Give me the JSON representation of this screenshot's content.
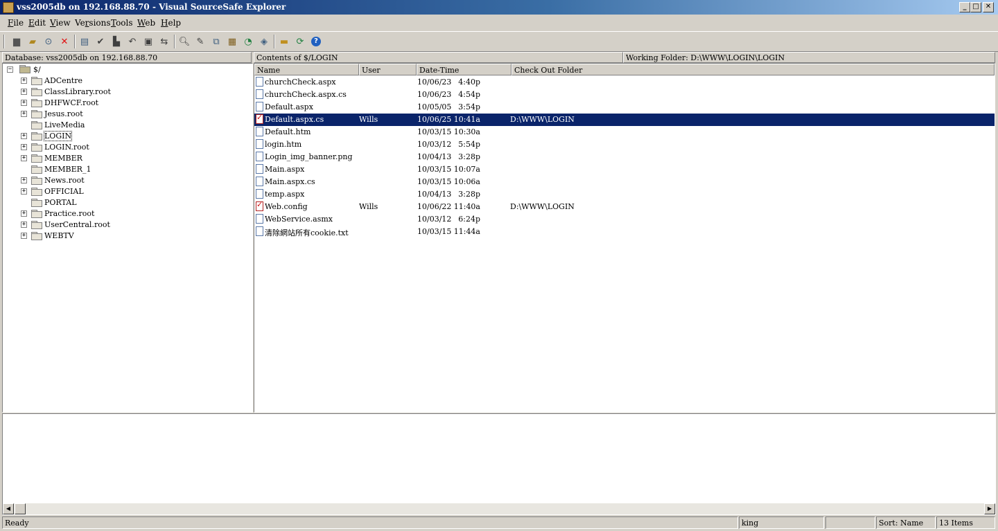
{
  "window": {
    "title": "vss2005db on 192.168.88.70 - Visual SourceSafe Explorer"
  },
  "menu": [
    {
      "key": "F",
      "rest": "ile"
    },
    {
      "key": "E",
      "rest": "dit"
    },
    {
      "key": "V",
      "rest": "iew"
    },
    {
      "pre": "Ve",
      "key": "r",
      "rest": "sions"
    },
    {
      "key": "T",
      "rest": "ools"
    },
    {
      "key": "W",
      "rest": "eb"
    },
    {
      "key": "H",
      "rest": "elp"
    }
  ],
  "toolbar_icons": [
    "create-project-icon",
    "add-files-icon",
    "share-icon",
    "delete-icon",
    "get-latest-icon",
    "check-out-icon",
    "check-in-icon",
    "undo-checkout-icon",
    "label-icon",
    "branch-icon",
    "find-icon",
    "edit-icon",
    "show-differences-icon",
    "properties-icon",
    "show-history-icon",
    "view-file-icon",
    "set-working-folder-icon",
    "refresh-icon",
    "help-icon"
  ],
  "tree_header": "Database: vss2005db on 192.168.88.70",
  "tree": {
    "root": "$/",
    "items": [
      {
        "label": "ADCentre",
        "expandable": true
      },
      {
        "label": "ClassLibrary.root",
        "expandable": true
      },
      {
        "label": "DHFWCF.root",
        "expandable": true
      },
      {
        "label": "Jesus.root",
        "expandable": true
      },
      {
        "label": "LiveMedia",
        "expandable": false
      },
      {
        "label": "LOGIN",
        "expandable": true,
        "selected": true
      },
      {
        "label": "LOGIN.root",
        "expandable": true
      },
      {
        "label": "MEMBER",
        "expandable": true
      },
      {
        "label": "MEMBER_1",
        "expandable": false
      },
      {
        "label": "News.root",
        "expandable": true
      },
      {
        "label": "OFFICIAL",
        "expandable": true
      },
      {
        "label": "PORTAL",
        "expandable": false
      },
      {
        "label": "Practice.root",
        "expandable": true
      },
      {
        "label": "UserCentral.root",
        "expandable": true
      },
      {
        "label": "WEBTV",
        "expandable": true
      }
    ]
  },
  "contents_header": "Contents of $/LOGIN",
  "working_folder": "Working Folder: D:\\WWW\\LOGIN\\LOGIN",
  "columns": [
    "Name",
    "User",
    "Date-Time",
    "Check Out Folder"
  ],
  "files": [
    {
      "name": "churchCheck.aspx",
      "user": "",
      "date": "10/06/23",
      "time": "4:40p",
      "folder": "",
      "checked": false
    },
    {
      "name": "churchCheck.aspx.cs",
      "user": "",
      "date": "10/06/23",
      "time": "4:54p",
      "folder": "",
      "checked": false
    },
    {
      "name": "Default.aspx",
      "user": "",
      "date": "10/05/05",
      "time": "3:54p",
      "folder": "",
      "checked": false
    },
    {
      "name": "Default.aspx.cs",
      "user": "Wills",
      "date": "10/06/25",
      "time": "10:41a",
      "folder": "D:\\WWW\\LOGIN",
      "checked": true,
      "selected": true
    },
    {
      "name": "Default.htm",
      "user": "",
      "date": "10/03/15",
      "time": "10:30a",
      "folder": "",
      "checked": false
    },
    {
      "name": "login.htm",
      "user": "",
      "date": "10/03/12",
      "time": "5:54p",
      "folder": "",
      "checked": false
    },
    {
      "name": "Login_img_banner.png",
      "user": "",
      "date": "10/04/13",
      "time": "3:28p",
      "folder": "",
      "checked": false
    },
    {
      "name": "Main.aspx",
      "user": "",
      "date": "10/03/15",
      "time": "10:07a",
      "folder": "",
      "checked": false
    },
    {
      "name": "Main.aspx.cs",
      "user": "",
      "date": "10/03/15",
      "time": "10:06a",
      "folder": "",
      "checked": false
    },
    {
      "name": "temp.aspx",
      "user": "",
      "date": "10/04/13",
      "time": "3:28p",
      "folder": "",
      "checked": false
    },
    {
      "name": "Web.config",
      "user": "Wills",
      "date": "10/06/22",
      "time": "11:40a",
      "folder": "D:\\WWW\\LOGIN",
      "checked": true
    },
    {
      "name": "WebService.asmx",
      "user": "",
      "date": "10/03/12",
      "time": "6:24p",
      "folder": "",
      "checked": false
    },
    {
      "name": "清除網站所有cookie.txt",
      "user": "",
      "date": "10/03/15",
      "time": "11:44a",
      "folder": "",
      "checked": false
    }
  ],
  "status": {
    "ready": "Ready",
    "user": "king",
    "sort": "Sort: Name",
    "items": "13 Items"
  },
  "colors": {
    "selection": "#0a246a",
    "face": "#d4d0c8"
  }
}
